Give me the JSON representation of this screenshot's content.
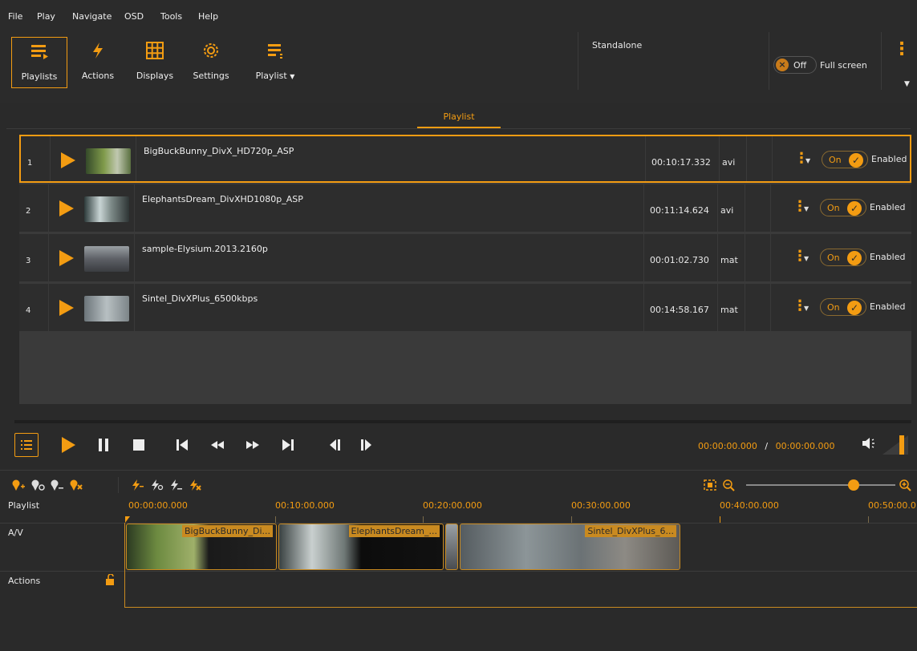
{
  "menu": [
    "File",
    "Play",
    "Navigate",
    "OSD",
    "Tools",
    "Help"
  ],
  "toolbar": {
    "playlists": "Playlists",
    "actions": "Actions",
    "displays": "Displays",
    "settings": "Settings",
    "playlist_menu": "Playlist",
    "standalone": "Standalone",
    "fullscreen_state": "Off",
    "fullscreen_label": "Full screen"
  },
  "tabs": {
    "playlist": "Playlist"
  },
  "playlist": {
    "rows": [
      {
        "index": "1",
        "name": "BigBuckBunny_DivX_HD720p_ASP",
        "duration": "00:10:17.332",
        "format": "avi",
        "state": "On",
        "status": "Enabled"
      },
      {
        "index": "2",
        "name": "ElephantsDream_DivXHD1080p_ASP",
        "duration": "00:11:14.624",
        "format": "avi",
        "state": "On",
        "status": "Enabled"
      },
      {
        "index": "3",
        "name": "sample-Elysium.2013.2160p",
        "duration": "00:01:02.730",
        "format": "mat",
        "state": "On",
        "status": "Enabled"
      },
      {
        "index": "4",
        "name": "Sintel_DivXPlus_6500kbps",
        "duration": "00:14:58.167",
        "format": "mat",
        "state": "On",
        "status": "Enabled"
      }
    ]
  },
  "transport": {
    "current_time": "00:00:00.000",
    "separator": "/",
    "total_time": "00:00:00.000"
  },
  "timeline": {
    "zoom_level": 0.72,
    "ruler": [
      "00:00:00.000",
      "00:10:00.000",
      "00:20:00.000",
      "00:30:00.000",
      "00:40:00.000",
      "00:50:00.0"
    ],
    "tracks": {
      "playlist": "Playlist",
      "av": "A/V",
      "actions": "Actions"
    },
    "clips": [
      "BigBuckBunny_Di...",
      "ElephantsDream_...",
      "Sintel_DivXPlus_6..."
    ]
  },
  "colors": {
    "accent": "#f39c12",
    "background": "#2a2a2a"
  }
}
